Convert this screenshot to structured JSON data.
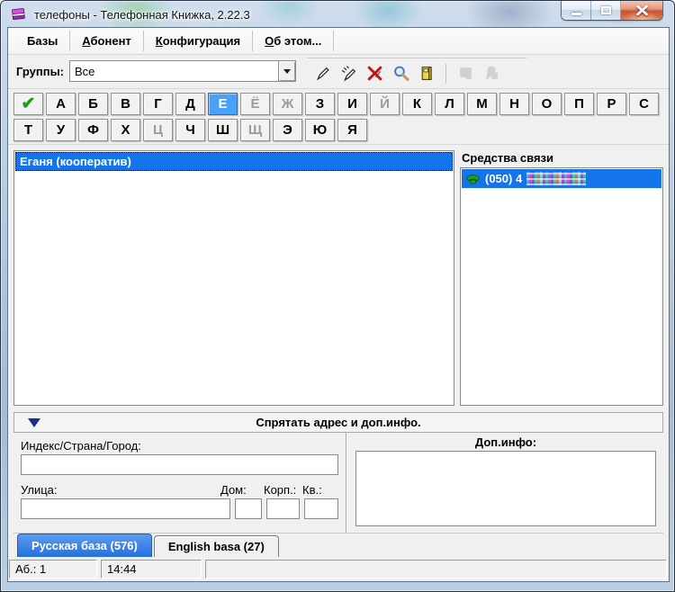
{
  "window": {
    "title": "телефоны - Телефонная Книжка, 2.22.3"
  },
  "menu": {
    "items": [
      {
        "u": "",
        "text": "Базы"
      },
      {
        "u": "А",
        "text": "бонент"
      },
      {
        "u": "К",
        "text": "онфигурация"
      },
      {
        "u": "О",
        "text": "б этом..."
      }
    ]
  },
  "toolbar": {
    "groups_label": "Группы:",
    "groups_value": "Все",
    "icons": [
      "pen-new",
      "pen-edit",
      "delete-red-x",
      "search-magnifier",
      "cardfile-yellow",
      "disabled-silhouette-1",
      "disabled-silhouette-2"
    ]
  },
  "alphabet": {
    "check_symbol": "✔",
    "row1": [
      {
        "ch": "А"
      },
      {
        "ch": "Б"
      },
      {
        "ch": "В"
      },
      {
        "ch": "Г"
      },
      {
        "ch": "Д"
      },
      {
        "ch": "Е",
        "state": "selected"
      },
      {
        "ch": "Ё",
        "state": "disabled"
      },
      {
        "ch": "Ж",
        "state": "disabled"
      },
      {
        "ch": "З"
      },
      {
        "ch": "И"
      },
      {
        "ch": "Й",
        "state": "disabled"
      },
      {
        "ch": "К"
      },
      {
        "ch": "Л"
      },
      {
        "ch": "М"
      },
      {
        "ch": "Н"
      },
      {
        "ch": "О"
      },
      {
        "ch": "П"
      },
      {
        "ch": "Р"
      },
      {
        "ch": "С"
      }
    ],
    "row2": [
      {
        "ch": "Т"
      },
      {
        "ch": "У"
      },
      {
        "ch": "Ф"
      },
      {
        "ch": "Х"
      },
      {
        "ch": "Ц",
        "state": "disabled"
      },
      {
        "ch": "Ч"
      },
      {
        "ch": "Ш"
      },
      {
        "ch": "Щ",
        "state": "disabled"
      },
      {
        "ch": "Э"
      },
      {
        "ch": "Ю"
      },
      {
        "ch": "Я"
      }
    ]
  },
  "abonent_list": {
    "items": [
      {
        "label": "Еганя (кооператив)",
        "state": "selected"
      }
    ]
  },
  "contacts_panel": {
    "title": "Средства связи",
    "items": [
      {
        "icon": "phone-green",
        "number_visible": "(050) 4",
        "censored": true
      }
    ]
  },
  "collapse_bar": {
    "label": "Спрятать адрес и доп.инфо."
  },
  "address": {
    "index_label": "Индекс/Страна/Город:",
    "index_value": "",
    "street_label": "Улица:",
    "street_value": "",
    "house_label": "Дом:",
    "house_value": "",
    "building_label": "Корп.:",
    "building_value": "",
    "apartment_label": "Кв.:",
    "apartment_value": ""
  },
  "info_panel": {
    "label": "Доп.инфо:",
    "value": ""
  },
  "tabs": [
    {
      "label": "Русская база (576)",
      "state": "active"
    },
    {
      "label": "English basa (27)",
      "state": "inactive"
    }
  ],
  "statusbar": {
    "cells": [
      "Аб.: 1",
      "14:44",
      ""
    ]
  },
  "colors": {
    "selection_blue": "#1474EC",
    "letter_selected_blue": "#4AA2F8",
    "tab_active_blue": "#2F7BE0",
    "close_button_red": "#C85336",
    "check_green": "#1E9E1E",
    "phone_icon_green": "#1FA11F",
    "collapse_triangle_navy": "#1A2F8A"
  }
}
